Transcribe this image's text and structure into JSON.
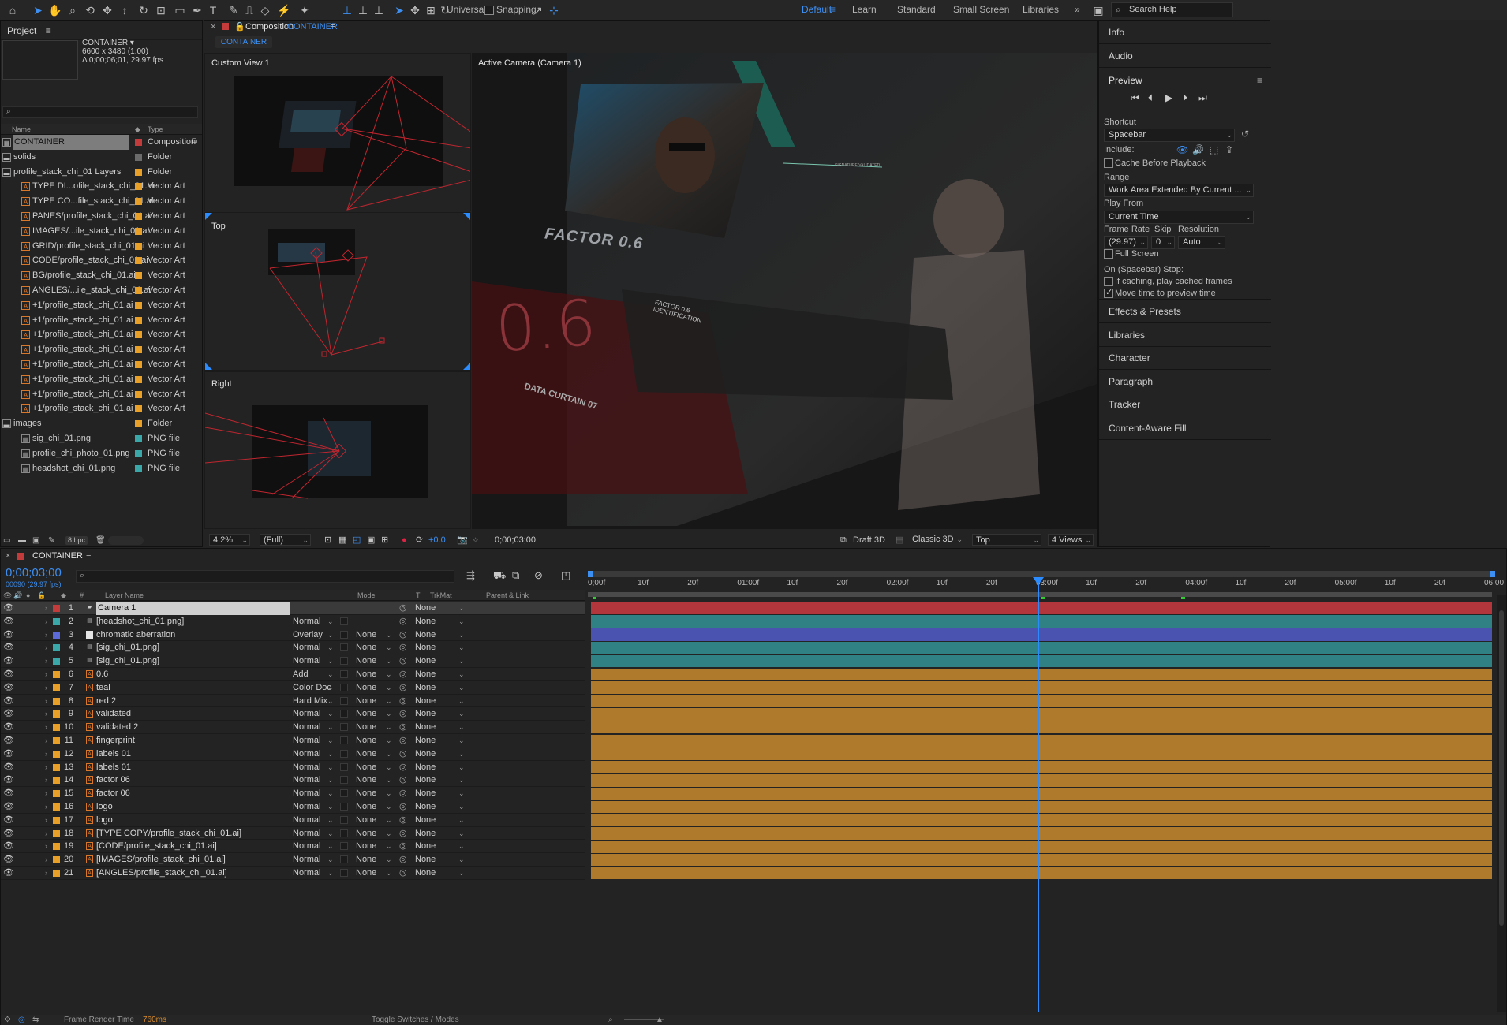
{
  "workspaces": [
    "Default",
    "Learn",
    "Standard",
    "Small Screen",
    "Libraries"
  ],
  "toolbar": {
    "universal_label": "Universal",
    "snapping_label": "Snapping",
    "search_placeholder": "Search Help"
  },
  "project": {
    "title": "Project",
    "comp_name": "CONTAINER ▾",
    "comp_size": "6600 x 3480 (1.00)",
    "comp_duration": "Δ 0;00;06;01, 29.97 fps",
    "col_name": "Name",
    "col_type": "Type",
    "bpc": "8 bpc",
    "items": [
      {
        "name": "CONTAINER",
        "type": "Composition",
        "color": "#c43b3b",
        "depth": 0,
        "selected": true,
        "icon": "comp"
      },
      {
        "name": "solids",
        "type": "Folder",
        "color": "#6b6b6b",
        "depth": 0,
        "icon": "folder"
      },
      {
        "name": "profile_stack_chi_01 Layers",
        "type": "Folder",
        "color": "#e8a028",
        "depth": 0,
        "icon": "folder"
      },
      {
        "name": "TYPE DI...ofile_stack_chi_01.ai",
        "type": "Vector Art",
        "color": "#e8a028",
        "depth": 1,
        "icon": "ai"
      },
      {
        "name": "TYPE CO...file_stack_chi_01.ai",
        "type": "Vector Art",
        "color": "#e8a028",
        "depth": 1,
        "icon": "ai"
      },
      {
        "name": "PANES/profile_stack_chi_01.ai",
        "type": "Vector Art",
        "color": "#e8a028",
        "depth": 1,
        "icon": "ai"
      },
      {
        "name": "IMAGES/...ile_stack_chi_01.ai",
        "type": "Vector Art",
        "color": "#e8a028",
        "depth": 1,
        "icon": "ai"
      },
      {
        "name": "GRID/profile_stack_chi_01.ai",
        "type": "Vector Art",
        "color": "#e8a028",
        "depth": 1,
        "icon": "ai"
      },
      {
        "name": "CODE/profile_stack_chi_01.ai",
        "type": "Vector Art",
        "color": "#e8a028",
        "depth": 1,
        "icon": "ai"
      },
      {
        "name": "BG/profile_stack_chi_01.ai",
        "type": "Vector Art",
        "color": "#e8a028",
        "depth": 1,
        "icon": "ai"
      },
      {
        "name": "ANGLES/...ile_stack_chi_01.ai",
        "type": "Vector Art",
        "color": "#e8a028",
        "depth": 1,
        "icon": "ai"
      },
      {
        "name": "+1/profile_stack_chi_01.ai",
        "type": "Vector Art",
        "color": "#e8a028",
        "depth": 1,
        "icon": "ai"
      },
      {
        "name": "+1/profile_stack_chi_01.ai",
        "type": "Vector Art",
        "color": "#e8a028",
        "depth": 1,
        "icon": "ai"
      },
      {
        "name": "+1/profile_stack_chi_01.ai",
        "type": "Vector Art",
        "color": "#e8a028",
        "depth": 1,
        "icon": "ai"
      },
      {
        "name": "+1/profile_stack_chi_01.ai",
        "type": "Vector Art",
        "color": "#e8a028",
        "depth": 1,
        "icon": "ai"
      },
      {
        "name": "+1/profile_stack_chi_01.ai",
        "type": "Vector Art",
        "color": "#e8a028",
        "depth": 1,
        "icon": "ai"
      },
      {
        "name": "+1/profile_stack_chi_01.ai",
        "type": "Vector Art",
        "color": "#e8a028",
        "depth": 1,
        "icon": "ai"
      },
      {
        "name": "+1/profile_stack_chi_01.ai",
        "type": "Vector Art",
        "color": "#e8a028",
        "depth": 1,
        "icon": "ai"
      },
      {
        "name": "+1/profile_stack_chi_01.ai",
        "type": "Vector Art",
        "color": "#e8a028",
        "depth": 1,
        "icon": "ai"
      },
      {
        "name": "images",
        "type": "Folder",
        "color": "#e8a028",
        "depth": 0,
        "icon": "folder"
      },
      {
        "name": "sig_chi_01.png",
        "type": "PNG file",
        "color": "#3aa8a8",
        "depth": 1,
        "icon": "file"
      },
      {
        "name": "profile_chi_photo_01.png",
        "type": "PNG file",
        "color": "#3aa8a8",
        "depth": 1,
        "icon": "file"
      },
      {
        "name": "headshot_chi_01.png",
        "type": "PNG file",
        "color": "#3aa8a8",
        "depth": 1,
        "icon": "file"
      }
    ]
  },
  "composition": {
    "tab_prefix": "Composition",
    "tab_name": "CONTAINER",
    "sub_tab": "CONTAINER",
    "views": {
      "custom": "Custom View 1",
      "top": "Top",
      "right": "Right",
      "active": "Active Camera (Camera 1)"
    },
    "overlay": {
      "factor": "FACTOR 0.6",
      "big_value": "0.6",
      "data_curtain": "DATA CURTAIN 07",
      "factor_id": "FACTOR 0.6 IDENTIFICATION",
      "sig": "SIGNATURE VALIDATED"
    },
    "footer": {
      "zoom": "4.2%",
      "resolution": "(Full)",
      "exposure": "+0.0",
      "timecode": "0;00;03;00",
      "draft3d": "Draft 3D",
      "renderer": "Classic 3D",
      "view": "Top",
      "layout": "4 Views"
    }
  },
  "right_panel": {
    "collapsed_top": [
      "Info",
      "Audio"
    ],
    "preview": {
      "title": "Preview",
      "shortcut_label": "Shortcut",
      "shortcut_value": "Spacebar",
      "include_label": "Include:",
      "cache_label": "Cache Before Playback",
      "range_label": "Range",
      "range_value": "Work Area Extended By Current ...",
      "play_from_label": "Play From",
      "play_from_value": "Current Time",
      "frame_rate_label": "Frame Rate",
      "skip_label": "Skip",
      "resolution_label": "Resolution",
      "frame_rate_value": "(29.97)",
      "skip_value": "0",
      "resolution_value": "Auto",
      "full_screen_label": "Full Screen",
      "on_stop_label": "On (Spacebar) Stop:",
      "if_caching_label": "If caching, play cached frames",
      "move_time_label": "Move time to preview time"
    },
    "collapsed_bottom": [
      "Effects & Presets",
      "Libraries",
      "Character",
      "Paragraph",
      "Tracker",
      "Content-Aware Fill"
    ]
  },
  "timeline": {
    "tab": "CONTAINER",
    "timecode": "0;00;03;00",
    "frames": "00090 (29.97 fps)",
    "col_num": "#",
    "col_layer": "Layer Name",
    "col_mode": "Mode",
    "col_t": "T",
    "col_trkmat": "TrkMat",
    "col_parent": "Parent & Link",
    "ruler": [
      "0;00f",
      "10f",
      "20f",
      "01:00f",
      "10f",
      "20f",
      "02:00f",
      "10f",
      "20f",
      "03:00f",
      "10f",
      "20f",
      "04:00f",
      "10f",
      "20f",
      "05:00f",
      "10f",
      "20f",
      "06:00"
    ],
    "footer_render": "Frame Render Time",
    "footer_ms": "760ms",
    "footer_toggle": "Toggle Switches / Modes",
    "layers": [
      {
        "num": "1",
        "name": "Camera 1",
        "mode": "",
        "trkmat": "",
        "parent": "None",
        "color": "#c43b3b",
        "bar": "#b4363d",
        "icon": "camera"
      },
      {
        "num": "2",
        "name": "[headshot_chi_01.png]",
        "mode": "Normal",
        "trkmat": "",
        "parent": "None",
        "color": "#3aa8a8",
        "bar": "#2f8184",
        "icon": "file"
      },
      {
        "num": "3",
        "name": "chromatic aberration",
        "mode": "Overlay",
        "trkmat": "None",
        "parent": "None",
        "color": "#5b6ad8",
        "bar": "#4a53b0",
        "icon": "solid"
      },
      {
        "num": "4",
        "name": "[sig_chi_01.png]",
        "mode": "Normal",
        "trkmat": "None",
        "parent": "None",
        "color": "#3aa8a8",
        "bar": "#2f8184",
        "icon": "file"
      },
      {
        "num": "5",
        "name": "[sig_chi_01.png]",
        "mode": "Normal",
        "trkmat": "None",
        "parent": "None",
        "color": "#3aa8a8",
        "bar": "#2f8184",
        "icon": "file"
      },
      {
        "num": "6",
        "name": "0.6",
        "mode": "Add",
        "trkmat": "None",
        "parent": "None",
        "color": "#e8a028",
        "bar": "#b07a2c",
        "icon": "ai"
      },
      {
        "num": "7",
        "name": "teal",
        "mode": "Color Doc",
        "trkmat": "None",
        "parent": "None",
        "color": "#e8a028",
        "bar": "#b07a2c",
        "icon": "ai"
      },
      {
        "num": "8",
        "name": "red 2",
        "mode": "Hard Mix",
        "trkmat": "None",
        "parent": "None",
        "color": "#e8a028",
        "bar": "#b07a2c",
        "icon": "ai"
      },
      {
        "num": "9",
        "name": "validated",
        "mode": "Normal",
        "trkmat": "None",
        "parent": "None",
        "color": "#e8a028",
        "bar": "#b07a2c",
        "icon": "ai"
      },
      {
        "num": "10",
        "name": "validated 2",
        "mode": "Normal",
        "trkmat": "None",
        "parent": "None",
        "color": "#e8a028",
        "bar": "#b07a2c",
        "icon": "ai"
      },
      {
        "num": "11",
        "name": "fingerprint",
        "mode": "Normal",
        "trkmat": "None",
        "parent": "None",
        "color": "#e8a028",
        "bar": "#b07a2c",
        "icon": "ai"
      },
      {
        "num": "12",
        "name": "labels 01",
        "mode": "Normal",
        "trkmat": "None",
        "parent": "None",
        "color": "#e8a028",
        "bar": "#b07a2c",
        "icon": "ai"
      },
      {
        "num": "13",
        "name": "labels 01",
        "mode": "Normal",
        "trkmat": "None",
        "parent": "None",
        "color": "#e8a028",
        "bar": "#b07a2c",
        "icon": "ai"
      },
      {
        "num": "14",
        "name": "factor 06",
        "mode": "Normal",
        "trkmat": "None",
        "parent": "None",
        "color": "#e8a028",
        "bar": "#b07a2c",
        "icon": "ai"
      },
      {
        "num": "15",
        "name": "factor 06",
        "mode": "Normal",
        "trkmat": "None",
        "parent": "None",
        "color": "#e8a028",
        "bar": "#b07a2c",
        "icon": "ai"
      },
      {
        "num": "16",
        "name": "logo",
        "mode": "Normal",
        "trkmat": "None",
        "parent": "None",
        "color": "#e8a028",
        "bar": "#b07a2c",
        "icon": "ai"
      },
      {
        "num": "17",
        "name": "logo",
        "mode": "Normal",
        "trkmat": "None",
        "parent": "None",
        "color": "#e8a028",
        "bar": "#b07a2c",
        "icon": "ai"
      },
      {
        "num": "18",
        "name": "[TYPE COPY/profile_stack_chi_01.ai]",
        "mode": "Normal",
        "trkmat": "None",
        "parent": "None",
        "color": "#e8a028",
        "bar": "#b07a2c",
        "icon": "ai"
      },
      {
        "num": "19",
        "name": "[CODE/profile_stack_chi_01.ai]",
        "mode": "Normal",
        "trkmat": "None",
        "parent": "None",
        "color": "#e8a028",
        "bar": "#b07a2c",
        "icon": "ai"
      },
      {
        "num": "20",
        "name": "[IMAGES/profile_stack_chi_01.ai]",
        "mode": "Normal",
        "trkmat": "None",
        "parent": "None",
        "color": "#e8a028",
        "bar": "#b07a2c",
        "icon": "ai"
      },
      {
        "num": "21",
        "name": "[ANGLES/profile_stack_chi_01.ai]",
        "mode": "Normal",
        "trkmat": "None",
        "parent": "None",
        "color": "#e8a028",
        "bar": "#b07a2c",
        "icon": "ai"
      }
    ]
  },
  "colors": {
    "accent": "#3d8ff2",
    "playhead": "#2b8cff",
    "selection": "#4a4a4a"
  }
}
